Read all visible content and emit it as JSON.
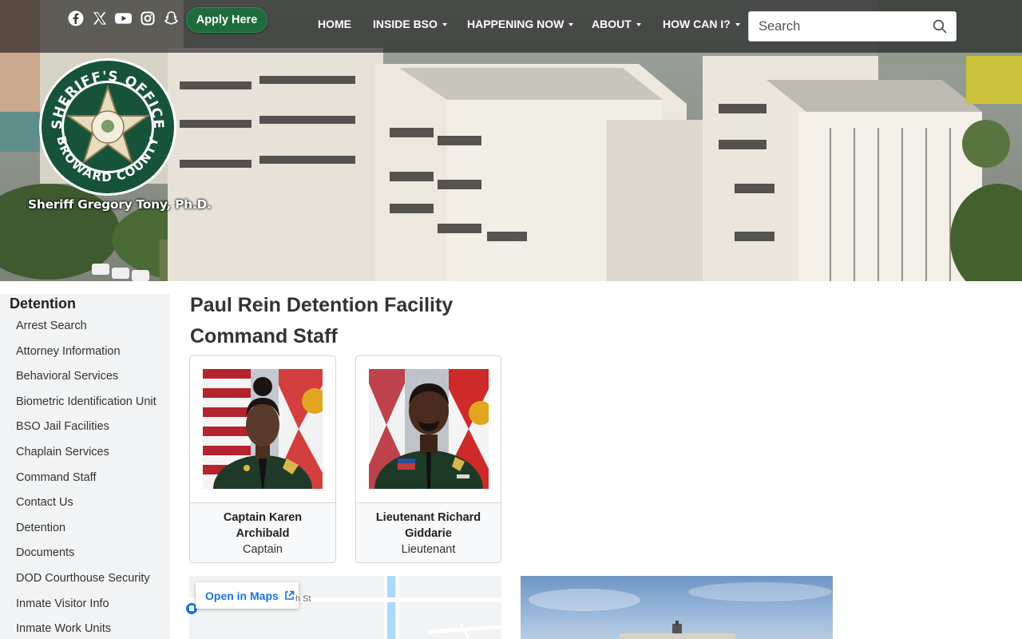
{
  "header": {
    "social_icons": [
      "facebook-icon",
      "x-icon",
      "youtube-icon",
      "instagram-icon",
      "snapchat-icon"
    ],
    "apply_label": "Apply Here",
    "nav": [
      {
        "label": "HOME",
        "dropdown": false
      },
      {
        "label": "INSIDE BSO",
        "dropdown": true
      },
      {
        "label": "HAPPENING NOW",
        "dropdown": true
      },
      {
        "label": "ABOUT",
        "dropdown": true
      },
      {
        "label": "HOW CAN I?",
        "dropdown": true
      }
    ],
    "search_placeholder": "Search",
    "logo_text_top": "SHERIFF'S OFFICE",
    "logo_text_bottom": "BROWARD COUNTY",
    "sheriff_name": "Sheriff Gregory Tony, Ph.D."
  },
  "sidebar": {
    "title": "Detention",
    "items": [
      "Arrest Search",
      "Attorney Information",
      "Behavioral Services",
      "Biometric Identification Unit",
      "BSO Jail Facilities",
      "Chaplain Services",
      "Command Staff",
      "Contact Us",
      "Detention",
      "Documents",
      "DOD Courthouse Security",
      "Inmate Visitor Info",
      "Inmate Work Units"
    ]
  },
  "main": {
    "page_title": "Paul Rein Detention Facility",
    "section_title": "Command Staff",
    "staff": [
      {
        "name": "Captain Karen Archibald",
        "rank": "Captain"
      },
      {
        "name": "Lieutenant Richard Giddarie",
        "rank": "Lieutenant"
      }
    ],
    "map": {
      "open_label": "Open in Maps",
      "street_fragment": "h St"
    }
  },
  "colors": {
    "brand_green": "#1f6b3c",
    "seal_green": "#17533a",
    "map_link": "#1a73e8",
    "sidebar_bg": "#f2f3f4"
  }
}
